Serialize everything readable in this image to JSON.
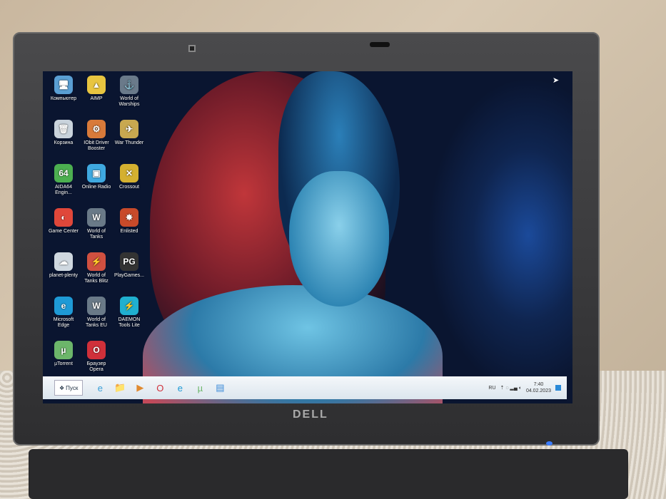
{
  "desktop": {
    "icons": [
      {
        "label": "Компьютер",
        "glyph": "🖥",
        "color": "#5a9fd4"
      },
      {
        "label": "AIMP",
        "glyph": "▲",
        "color": "#e8c540"
      },
      {
        "label": "World of Warships",
        "glyph": "⚓",
        "color": "#6a7a8a"
      },
      {
        "label": "Корзина",
        "glyph": "🗑",
        "color": "#c9d3dc"
      },
      {
        "label": "IObit Driver Booster",
        "glyph": "⚙",
        "color": "#d87a3a"
      },
      {
        "label": "War Thunder",
        "glyph": "✈",
        "color": "#c8a850"
      },
      {
        "label": "AIDA64 Engin...",
        "glyph": "64",
        "color": "#4caf50"
      },
      {
        "label": "Online Radio",
        "glyph": "▣",
        "color": "#3fa9e0"
      },
      {
        "label": "Crossout",
        "glyph": "✕",
        "color": "#d4b030"
      },
      {
        "label": "Game Center",
        "glyph": "◐",
        "color": "#e0473a"
      },
      {
        "label": "World of Tanks",
        "glyph": "W",
        "color": "#6a7a88"
      },
      {
        "label": "Enlisted",
        "glyph": "✸",
        "color": "#c84a2a"
      },
      {
        "label": "planet-plenty",
        "glyph": "☁",
        "color": "#cfd8e0"
      },
      {
        "label": "World of Tanks Blitz",
        "glyph": "⚡",
        "color": "#d05040"
      },
      {
        "label": "PlayGames...",
        "glyph": "PG",
        "color": "#333"
      },
      {
        "label": "Microsoft Edge",
        "glyph": "e",
        "color": "#1e9ad6"
      },
      {
        "label": "World of Tanks EU",
        "glyph": "W",
        "color": "#6a7a88"
      },
      {
        "label": "DAEMON Tools Lite",
        "glyph": "⚡",
        "color": "#20b0d0"
      },
      {
        "label": "µTorrent",
        "glyph": "µ",
        "color": "#6cb66a"
      },
      {
        "label": "Браузер Opera",
        "glyph": "O",
        "color": "#d0303a"
      }
    ]
  },
  "taskbar": {
    "start_label": "Пуск",
    "items": [
      {
        "name": "internet-explorer",
        "glyph": "e"
      },
      {
        "name": "file-explorer",
        "glyph": "📁"
      },
      {
        "name": "media-player",
        "glyph": "▶"
      },
      {
        "name": "opera",
        "glyph": "O"
      },
      {
        "name": "edge",
        "glyph": "e"
      },
      {
        "name": "utorrent",
        "glyph": "µ"
      },
      {
        "name": "show-desktop",
        "glyph": "▤"
      }
    ],
    "language": "RU",
    "time": "7:40",
    "date": "04.02.2023"
  },
  "laptop": {
    "brand": "DELL"
  }
}
